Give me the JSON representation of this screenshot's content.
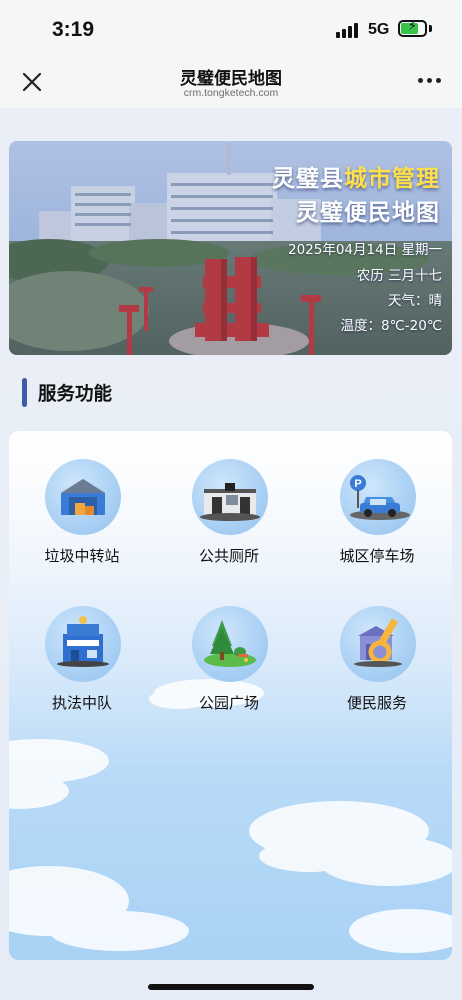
{
  "status_bar": {
    "time": "3:19",
    "network": "5G",
    "battery_percent": 0.75
  },
  "nav": {
    "title": "灵璧便民地图",
    "subtitle": "crm.tongketech.com",
    "close_icon": "close-icon",
    "more_icon": "more-icon"
  },
  "banner": {
    "title_line1_prefix": "灵璧县",
    "title_line1_highlight": "城市管理",
    "title_line2": "灵璧便民地图",
    "date": "2025年04月14日 星期一",
    "lunar": "农历 三月十七",
    "weather": "天气：晴",
    "temperature": "温度：8℃-20℃"
  },
  "section": {
    "title": "服务功能"
  },
  "services": [
    {
      "label": "垃圾中转站",
      "icon": "warehouse-icon"
    },
    {
      "label": "公共厕所",
      "icon": "toilet-building-icon"
    },
    {
      "label": "城区停车场",
      "icon": "parking-car-icon"
    },
    {
      "label": "执法中队",
      "icon": "police-station-icon"
    },
    {
      "label": "公园广场",
      "icon": "park-tree-icon"
    },
    {
      "label": "便民服务",
      "icon": "service-wrench-icon"
    }
  ],
  "colors": {
    "accent": "#3e5aa8",
    "highlight": "#ffe04a",
    "battery": "#39c24a"
  }
}
